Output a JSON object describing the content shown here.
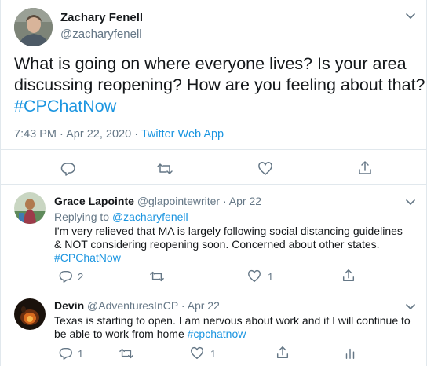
{
  "main_tweet": {
    "name": "Zachary Fenell",
    "handle": "@zacharyfenell",
    "text_lines": [
      "What is going on where everyone lives? Is your area",
      "discussing reopening? How are you feeling about that?"
    ],
    "hashtag": "#CPChatNow",
    "time": "7:43 PM",
    "date": "Apr 22, 2020",
    "separator": "·",
    "source": "Twitter Web App"
  },
  "replies": [
    {
      "name": "Grace Lapointe",
      "handle": "@glapointewriter",
      "date": "Apr 22",
      "separator": "·",
      "replying_prefix": "Replying to",
      "replying_to": "@zacharyfenell",
      "text_lines": [
        "I'm very relieved that MA is largely following social distancing guidelines",
        "& NOT considering reopening soon. Concerned about other states."
      ],
      "hashtag": "#CPChatNow",
      "reply_count": "2",
      "retweet_count": "",
      "like_count": "1"
    },
    {
      "name": "Devin",
      "handle": "@AdventuresInCP",
      "date": "Apr 22",
      "separator": "·",
      "text_line1": "Texas is starting to open. I am nervous about work and if I will continue to",
      "text_line2_prefix": "be able to work from home",
      "hashtag": "#cpchatnow",
      "reply_count": "1",
      "retweet_count": "",
      "like_count": "1"
    }
  ],
  "icons": {
    "more": "chevron-down-icon",
    "reply": "reply-icon",
    "retweet": "retweet-icon",
    "like": "heart-icon",
    "share": "share-icon",
    "analytics": "analytics-icon"
  },
  "colors": {
    "link": "#1b95e0",
    "muted": "#657786",
    "text": "#14171a",
    "divider": "#e1e8ed"
  }
}
